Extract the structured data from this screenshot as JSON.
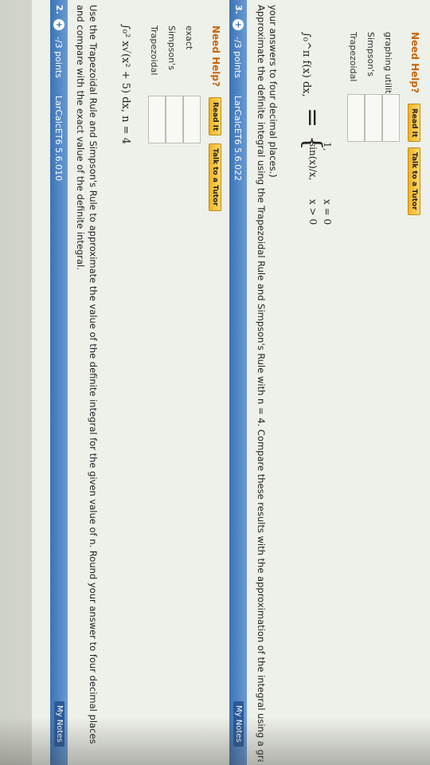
{
  "q2": {
    "number": "2.",
    "points": "-/3 points",
    "id": "LarCalcET6 5.6.010",
    "instruction": "Use the Trapezoidal Rule and Simpson's Rule to approximate the value of the definite integral for the given value of n. Round your answer to four decimal places and compare with the exact value of the definite integral.",
    "integral": "∫₀² x√(x² + 5) dx,  n = 4",
    "labels": [
      "Trapezoidal",
      "Simpson's",
      "exact"
    ],
    "need_help": "Need Help?",
    "read_it": "Read It",
    "talk_tutor": "Talk to a Tutor",
    "my_notes": "My Notes"
  },
  "q3": {
    "number": "3.",
    "points": "-/3 points",
    "id": "LarCalcET6 5.6.022",
    "instruction_line1": "Approximate the definite integral using the Trapezoidal Rule and Simpson's Rule with n = 4. Compare these results with the approximation of the integral using a graphing utility.",
    "instruction_line2": "your answers to four decimal places.)",
    "integral_lhs": "∫₀^π f(x) dx,",
    "piecewise_1": "sin(x)/x,",
    "piecewise_1_cond": "x > 0",
    "piecewise_2": "1,",
    "piecewise_2_cond": "x = 0",
    "labels": [
      "Trapezoidal",
      "Simpson's",
      "graphing utility"
    ],
    "need_help": "Need Help?",
    "read_it": "Read It",
    "talk_tutor": "Talk to a Tutor",
    "my_notes": "My Notes"
  }
}
